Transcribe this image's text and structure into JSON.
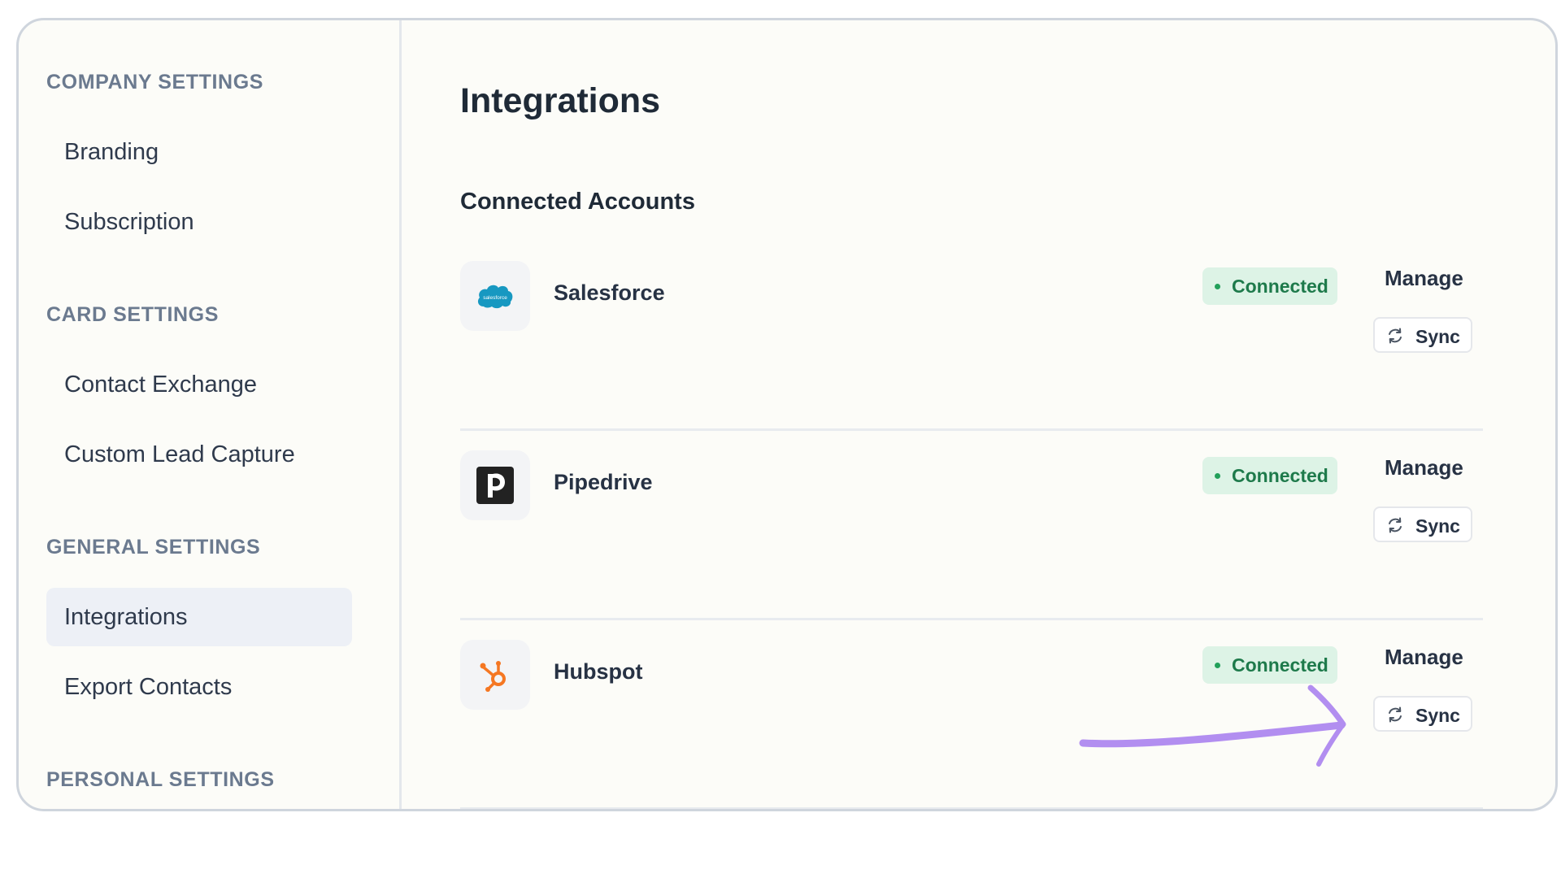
{
  "sidebar": {
    "sections": [
      {
        "label": "COMPANY SETTINGS",
        "items": [
          "Branding",
          "Subscription"
        ]
      },
      {
        "label": "CARD SETTINGS",
        "items": [
          "Contact Exchange",
          "Custom Lead Capture"
        ]
      },
      {
        "label": "GENERAL SETTINGS",
        "items": [
          "Integrations",
          "Export Contacts"
        ]
      },
      {
        "label": "PERSONAL SETTINGS",
        "items": []
      }
    ],
    "active_item": "Integrations"
  },
  "main": {
    "title": "Integrations",
    "section_title": "Connected Accounts",
    "integrations": [
      {
        "name": "Salesforce",
        "icon": "salesforce-logo",
        "status": "Connected",
        "manage_label": "Manage",
        "sync_label": "Sync",
        "logo_text": "salesforce"
      },
      {
        "name": "Pipedrive",
        "icon": "pipedrive-logo",
        "status": "Connected",
        "manage_label": "Manage",
        "sync_label": "Sync"
      },
      {
        "name": "Hubspot",
        "icon": "hubspot-logo",
        "status": "Connected",
        "manage_label": "Manage",
        "sync_label": "Sync"
      }
    ]
  },
  "colors": {
    "status_bg": "#ddf3e6",
    "status_text": "#1e7a4b",
    "annotation_arrow": "#b28ef0",
    "salesforce_blue": "#1798c1",
    "hubspot_orange": "#f57722"
  }
}
